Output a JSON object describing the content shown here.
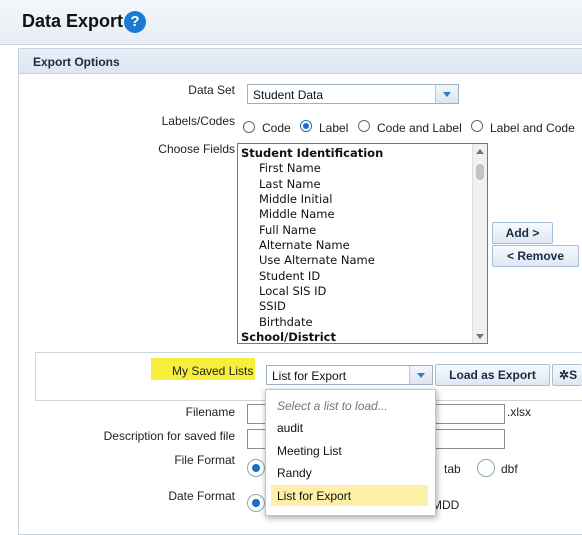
{
  "header": {
    "title": "Data Export",
    "help_label": "?"
  },
  "export_options": {
    "title": "Export Options",
    "data_set": {
      "label": "Data Set",
      "value": "Student Data"
    },
    "labels_codes": {
      "label": "Labels/Codes",
      "options": [
        "Code",
        "Label",
        "Code and Label",
        "Label and Code"
      ],
      "selected": "Label"
    },
    "choose_fields": {
      "label": "Choose Fields",
      "group": "Student Identification",
      "items": [
        "First Name",
        "Last Name",
        "Middle Initial",
        "Middle Name",
        "Full Name",
        "Alternate Name",
        "Use Alternate Name",
        "Student ID",
        "Local SIS ID",
        "SSID",
        "Birthdate"
      ],
      "next_group": "School/District"
    },
    "add_button": "Add >",
    "remove_button": "< Remove"
  },
  "saved_lists": {
    "label": "My Saved Lists",
    "value": "List for Export",
    "load_button": "Load as Export",
    "next_button_partial": "S",
    "dropdown": {
      "placeholder": "Select a list to load...",
      "options": [
        "audit",
        "Meeting List",
        "Randy",
        "List for Export"
      ],
      "highlighted": "List for Export"
    }
  },
  "filename": {
    "label": "Filename",
    "suffix": ".xlsx"
  },
  "description": {
    "label": "Description for saved file"
  },
  "file_format": {
    "label": "File Format",
    "options_visible": [
      "tab",
      "dbf"
    ]
  },
  "date_format": {
    "label": "Date Format",
    "partial_option": "MDD"
  },
  "colors": {
    "accent": "#1a7ad1",
    "highlight": "#f7ee3c",
    "dropdown_highlight": "#fcefa7"
  }
}
